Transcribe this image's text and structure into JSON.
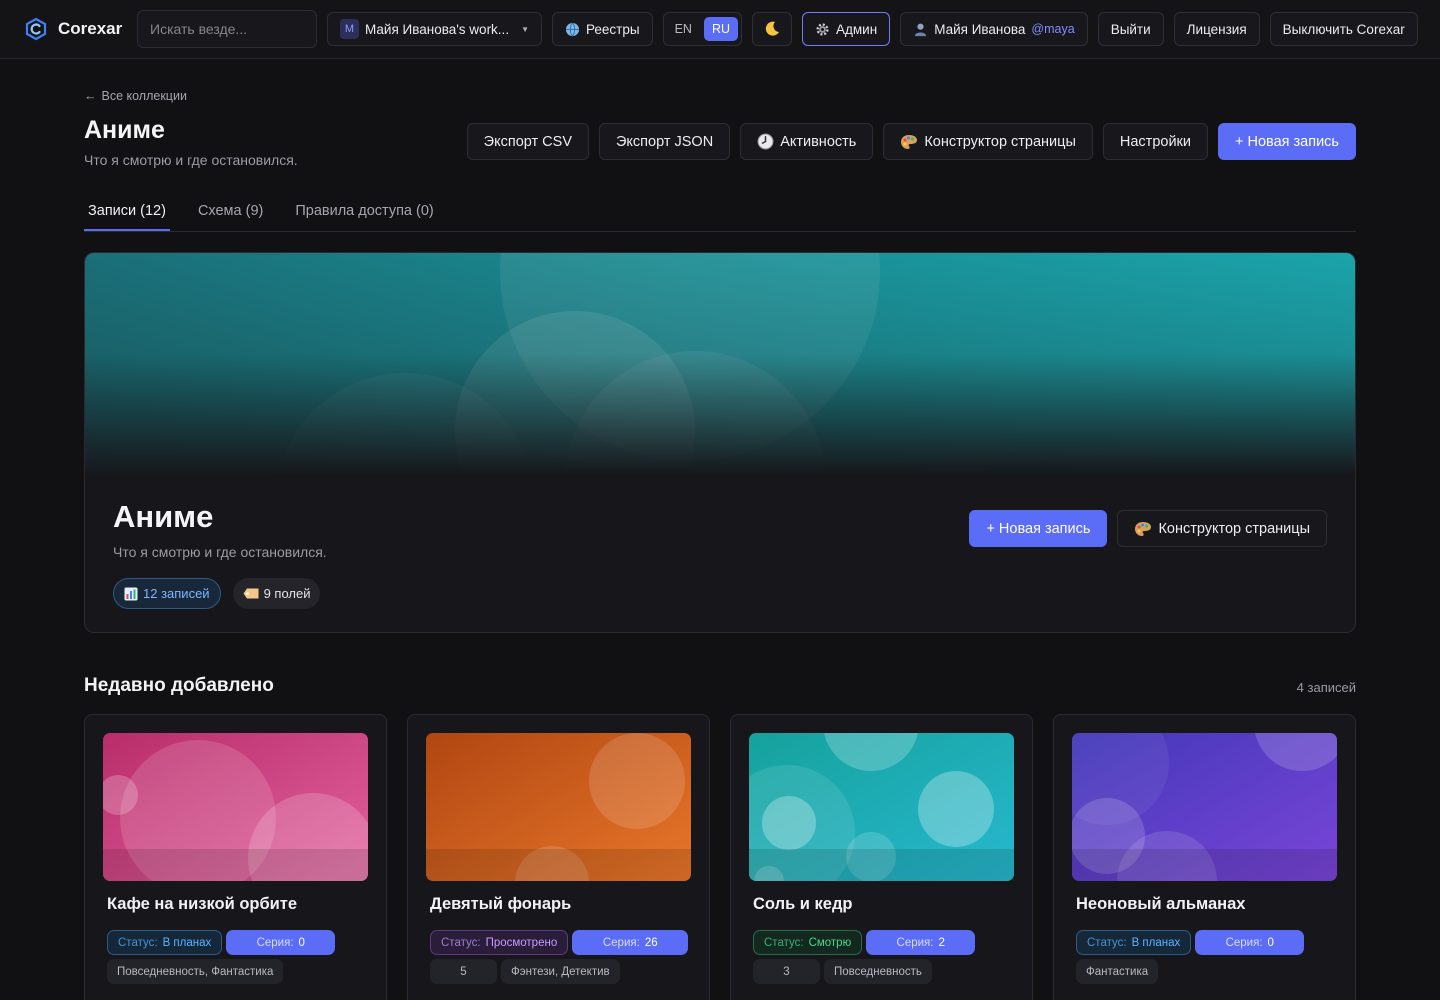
{
  "topbar": {
    "brand": "Corexar",
    "search_placeholder": "Искать везде...",
    "workspace_initial": "M",
    "workspace": "Майя Иванова's work...",
    "registries": "Реестры",
    "lang_en": "EN",
    "lang_ru": "RU",
    "theme_icon": "moon-icon",
    "admin": "Админ",
    "user_name": "Майя Иванова",
    "user_handle": "@maya",
    "logout": "Выйти",
    "license": "Лицензия",
    "disable": "Выключить Corexar"
  },
  "header": {
    "back": "Все коллекции",
    "title": "Аниме",
    "subtitle": "Что я смотрю и где остановился.",
    "actions": {
      "export_csv": "Экспорт CSV",
      "export_json": "Экспорт JSON",
      "activity": "Активность",
      "page_builder": "Конструктор страницы",
      "settings": "Настройки",
      "new_record": "+ Новая запись"
    }
  },
  "tabs": [
    {
      "label": "Записи (12)"
    },
    {
      "label": "Схема (9)"
    },
    {
      "label": "Правила доступа (0)"
    }
  ],
  "hero": {
    "title": "Аниме",
    "subtitle": "Что я смотрю и где остановился.",
    "new_record": "+ Новая запись",
    "page_builder": "Конструктор страницы",
    "records_chip": "12 записей",
    "fields_chip": "9 полей",
    "banner_color": "#1a9aa0"
  },
  "recent": {
    "title": "Недавно добавлено",
    "count": "4 записей",
    "status_key": "Статус:",
    "episode_key": "Серия:",
    "cards": [
      {
        "title": "Кафе на низкой орбите",
        "status": "В планах",
        "episode": "0",
        "genres": "Повседневность, Фантастика",
        "colors": [
          "#c23a78",
          "#e46aa4"
        ]
      },
      {
        "title": "Девятый фонарь",
        "status": "Просмотрено",
        "episode": "26",
        "rating": "5",
        "genres": "Фэнтези, Детектив",
        "colors": [
          "#b84a14",
          "#e8772a"
        ]
      },
      {
        "title": "Соль и кедр",
        "status": "Смотрю",
        "episode": "2",
        "rating": "3",
        "genres": "Повседневность",
        "colors": [
          "#17a3a0",
          "#27b9cc"
        ]
      },
      {
        "title": "Неоновый альманах",
        "status": "В планах",
        "episode": "0",
        "genres": "Фантастика",
        "colors": [
          "#4a3fbf",
          "#7446d8"
        ]
      }
    ]
  }
}
